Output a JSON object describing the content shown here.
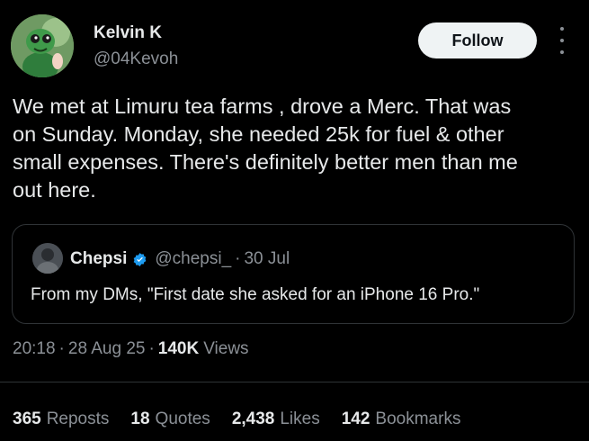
{
  "author": {
    "name": "Kelvin K",
    "handle": "@04Kevoh"
  },
  "follow_label": "Follow",
  "tweet_text": "We met at Limuru tea farms , drove a Merc. That was\non Sunday. Monday, she needed 25k for fuel & other\nsmall expenses. There's definitely better men than me\nout here.",
  "quote": {
    "name": "Chepsi",
    "handle": "@chepsi_",
    "separator": "·",
    "date": "30 Jul",
    "text": "From my DMs, \"First date she asked for an iPhone 16 Pro.\"",
    "verified_color": "#1d9bf0"
  },
  "meta": {
    "time": "20:18",
    "separator": "·",
    "date": "28 Aug 25",
    "views_count": "140K",
    "views_label": "Views"
  },
  "stats": [
    {
      "count": "365",
      "label": "Reposts"
    },
    {
      "count": "18",
      "label": "Quotes"
    },
    {
      "count": "2,438",
      "label": "Likes"
    },
    {
      "count": "142",
      "label": "Bookmarks"
    }
  ],
  "icons": {
    "more": "more-vertical-icon",
    "verified": "verified-badge-icon"
  },
  "colors": {
    "background": "#000000",
    "text": "#e7e9ea",
    "muted": "#8b9096",
    "border": "#2f3336",
    "follow_bg": "#eff3f4"
  }
}
